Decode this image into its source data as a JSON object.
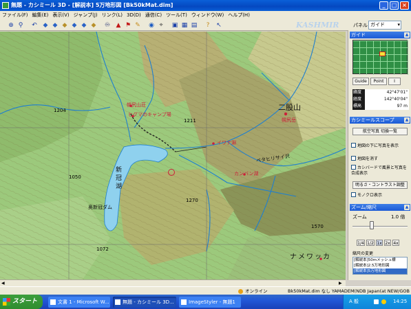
{
  "window": {
    "title": "無題 - カシミール 3D - [解説本] 5万地形図 [Bk50kMat.dim]",
    "minimize": "_",
    "maximize": "□",
    "close": "×"
  },
  "menu": [
    "ファイル(F)",
    "編集(E)",
    "表示(V)",
    "ジャンプ(J)",
    "リンク(L)",
    "3D(D)",
    "通信(C)",
    "ツール(T)",
    "ウィンドウ(W)",
    "ヘルプ(H)"
  ],
  "toolbar": {
    "brand": "KASHMIR 3D",
    "panel_label": "パネル",
    "panel_value": "ガイド"
  },
  "map": {
    "labels": [
      "二股山",
      "1204",
      "1050",
      "1211",
      "1270",
      "1570",
      "1072",
      "イワナ淵",
      "奥新冠ダム",
      "幌尻山荘",
      "ヒグマのキャンプ場",
      "ナメワッカ",
      "新冠湖",
      "カンバン湖",
      "ペタヒリサイ沢",
      "幌尻岳"
    ]
  },
  "guide": {
    "section_title": "ガイド",
    "buttons": [
      "Guide",
      "Point",
      "I"
    ],
    "lat_label": "緯度",
    "lat_value": "42°47'01\"",
    "lon_label": "経度",
    "lon_value": "142°40'04\"",
    "elev_label": "標高",
    "elev_value": "97 m"
  },
  "kashmir_scope": {
    "section_title": "カシミールスコープ",
    "button": "航空写真 切換一覧",
    "checks": [
      {
        "label": "地図の下に写真を表示",
        "checked": false
      },
      {
        "label": "地図を消す",
        "checked": false
      },
      {
        "label": "カシバードで風景と写真を合成表示",
        "checked": false
      }
    ],
    "brightness_button": "明るさ・コントラスト調整",
    "mono_check": "モノクロ表示"
  },
  "zoom": {
    "section_title": "ズーム/縮尺",
    "label": "ズーム",
    "value": "1.0 倍",
    "slider_fraction": 0.25,
    "buttons": [
      "1/4",
      "1/2",
      "1x",
      "2x",
      "4x"
    ],
    "scale_label": "縮尺の変更",
    "scales": [
      {
        "text": "[解説本]50mメッシュ標",
        "selected": false
      },
      {
        "text": "[解説本]2.5万地形図",
        "selected": false
      },
      {
        "text": "[解説本]5万地形図",
        "selected": true
      }
    ]
  },
  "status": {
    "online": "オンライン",
    "info": "Bk50kMat.dim  なし  YAMADEM(NDB  Japan(at  NEW/GOB"
  },
  "taskbar": {
    "start": "スタート",
    "tasks": [
      "文書 1 - Microsoft W...",
      "無題 - カシミール 3D...",
      "ImageStyler - 無題1"
    ],
    "ime": "A 般",
    "clock": "14:25"
  },
  "colors": {
    "title_bar": "#0a5fd8",
    "map_base": "#9cc97c",
    "water": "#8fd1ee",
    "taskbar": "#2157d7"
  }
}
